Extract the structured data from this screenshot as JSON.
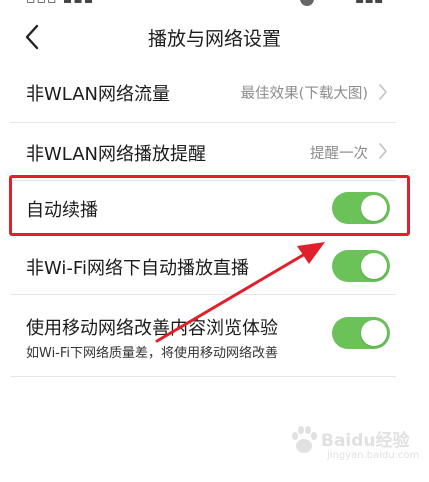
{
  "status_bar": {
    "left_text": "▫▫▫ ▪▪▪",
    "right_text": "▪▪▪"
  },
  "header": {
    "title": "播放与网络设置"
  },
  "settings": [
    {
      "label": "非WLAN网络流量",
      "value": "最佳效果(下载大图)",
      "type": "chevron"
    },
    {
      "label": "非WLAN网络播放提醒",
      "value": "提醒一次",
      "type": "chevron"
    },
    {
      "label": "自动续播",
      "type": "toggle",
      "enabled": true
    },
    {
      "label": "非Wi-Fi网络下自动播放直播",
      "type": "toggle",
      "enabled": true
    },
    {
      "label": "使用移动网络改善内容浏览体验",
      "sublabel": "如Wi-Fi下网络质量差，将使用移动网络改善",
      "type": "toggle",
      "enabled": true
    }
  ],
  "colors": {
    "toggle_on": "#6ac259",
    "highlight": "#e0202a",
    "arrow": "#e0202a"
  },
  "icons": {
    "back": "chevron-left-icon",
    "row_arrow": "chevron-right-icon"
  },
  "watermark": {
    "text": "Baidu经验",
    "sub": "jingyan.baidu.com"
  }
}
